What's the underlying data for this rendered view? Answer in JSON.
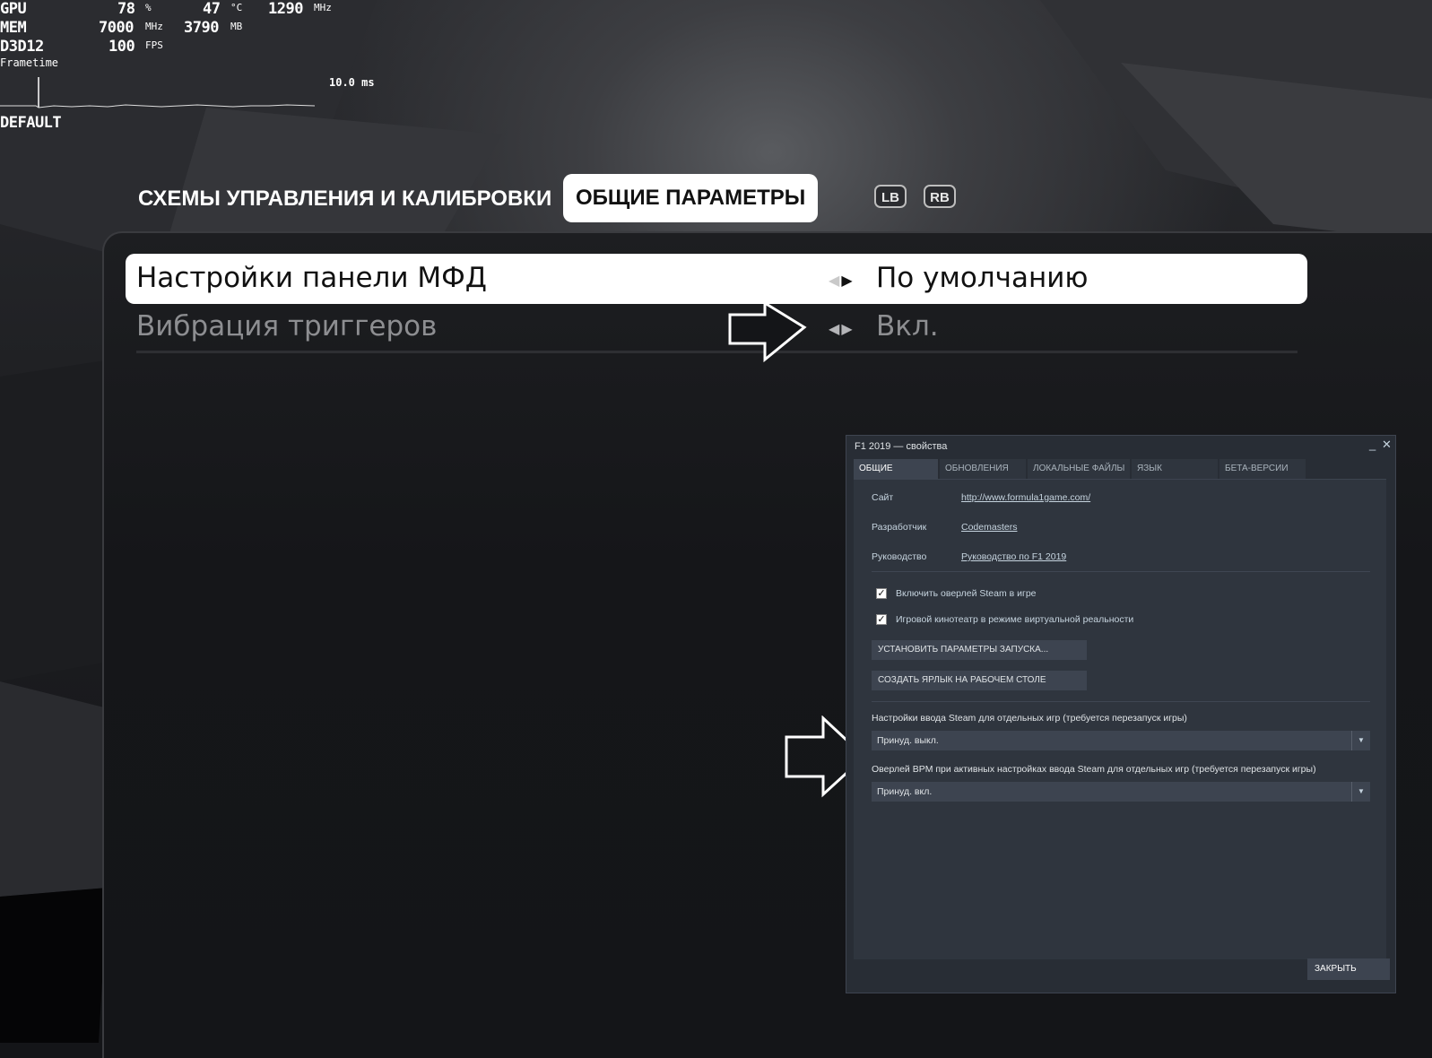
{
  "hud": {
    "gpu_label": "GPU",
    "gpu_load": "78",
    "gpu_load_unit": "%",
    "gpu_temp": "47",
    "gpu_temp_unit": "°C",
    "gpu_clock": "1290",
    "gpu_clock_unit": "MHz",
    "mem_label": "MEM",
    "mem_clock": "7000",
    "mem_clock_unit": "MHz",
    "mem_used": "3790",
    "mem_used_unit": "MB",
    "api_label": "D3D12",
    "fps": "100",
    "fps_unit": "FPS",
    "frametime_label": "Frametime",
    "frametime_value": "10.0 ms",
    "profile": "DEFAULT"
  },
  "game_menu": {
    "tabs": [
      "СХЕМЫ УПРАВЛЕНИЯ И КАЛИБРОВКИ",
      "ОБЩИЕ ПАРАМЕТРЫ"
    ],
    "active_tab": 1,
    "shoulder_left": "LB",
    "shoulder_right": "RB",
    "rows": [
      {
        "label": "Настройки панели МФД",
        "value": "По умолчанию"
      },
      {
        "label": "Вибрация триггеров",
        "value": "Вкл."
      }
    ]
  },
  "steam_dialog": {
    "title": "F1 2019 — свойства",
    "minimize": "_",
    "close": "✕",
    "tabs": [
      "ОБЩИЕ",
      "ОБНОВЛЕНИЯ",
      "ЛОКАЛЬНЫЕ ФАЙЛЫ",
      "ЯЗЫК",
      "БЕТА-ВЕРСИИ"
    ],
    "site_label": "Сайт",
    "site_value": "http://www.formula1game.com/",
    "developer_label": "Разработчик",
    "developer_value": "Codemasters",
    "guide_label": "Руководство",
    "guide_value": "Руководство по F1 2019",
    "checkbox_overlay": "Включить оверлей Steam в игре",
    "checkbox_vr": "Игровой кинотеатр в режиме виртуальной реальности",
    "btn_launch_options": "УСТАНОВИТЬ ПАРАМЕТРЫ ЗАПУСКА...",
    "btn_shortcut": "СОЗДАТЬ ЯРЛЫК НА РАБОЧЕМ СТОЛЕ",
    "input_setting_label": "Настройки ввода Steam для отдельных игр (требуется перезапуск игры)",
    "input_setting_value": "Принуд. выкл.",
    "bpm_setting_label": "Оверлей BPM при активных настройках ввода Steam для отдельных игр (требуется перезапуск игры)",
    "bpm_setting_value": "Принуд. вкл.",
    "close_button": "ЗАКРЫТЬ"
  }
}
